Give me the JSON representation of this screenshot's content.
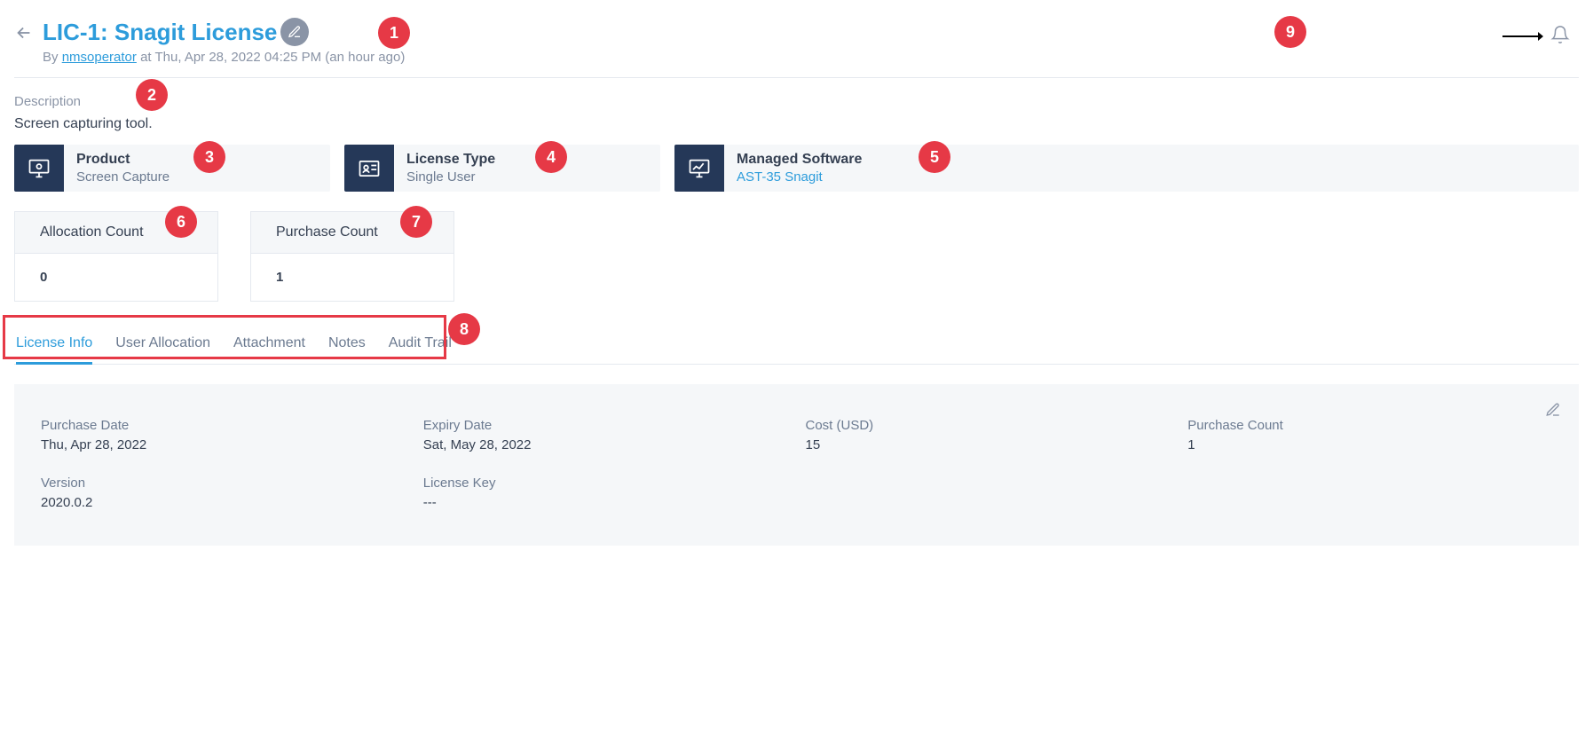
{
  "header": {
    "title": "LIC-1: Snagit License",
    "meta_prefix": "By ",
    "author": "nmsoperator",
    "meta_suffix": " at Thu, Apr 28, 2022 04:25 PM (an hour ago)"
  },
  "description": {
    "label": "Description",
    "value": "Screen capturing tool."
  },
  "panels": {
    "product": {
      "title": "Product",
      "value": "Screen Capture"
    },
    "license_type": {
      "title": "License Type",
      "value": "Single User"
    },
    "managed_software": {
      "title": "Managed Software",
      "value": "AST-35 Snagit"
    }
  },
  "cards": {
    "allocation": {
      "label": "Allocation Count",
      "value": "0"
    },
    "purchase": {
      "label": "Purchase Count",
      "value": "1"
    }
  },
  "tabs": {
    "t1": "License Info",
    "t2": "User Allocation",
    "t3": "Attachment",
    "t4": "Notes",
    "t5": "Audit Trail"
  },
  "info": {
    "purchase_date": {
      "label": "Purchase Date",
      "value": "Thu, Apr 28, 2022"
    },
    "expiry_date": {
      "label": "Expiry Date",
      "value": "Sat, May 28, 2022"
    },
    "cost": {
      "label": "Cost (USD)",
      "value": "15"
    },
    "purchase_count": {
      "label": "Purchase Count",
      "value": "1"
    },
    "version": {
      "label": "Version",
      "value": "2020.0.2"
    },
    "license_key": {
      "label": "License Key",
      "value": "---"
    }
  },
  "badges": {
    "b1": "1",
    "b2": "2",
    "b3": "3",
    "b4": "4",
    "b5": "5",
    "b6": "6",
    "b7": "7",
    "b8": "8",
    "b9": "9"
  }
}
